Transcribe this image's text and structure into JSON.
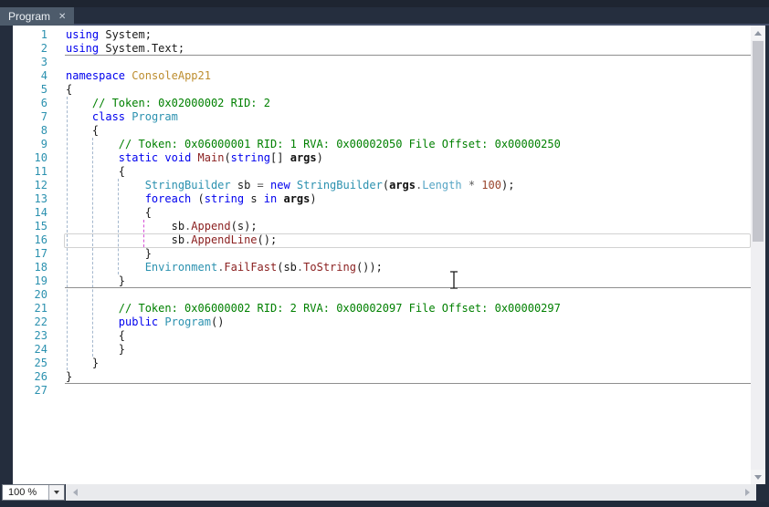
{
  "tab_bar": {
    "tabs": [
      {
        "label": "Program",
        "close_icon": "✕",
        "active": true
      }
    ]
  },
  "zoom_control": {
    "value": "100 %"
  },
  "colors": {
    "chrome_dark": "#242D3D",
    "chrome_top_strip": "#1E2531",
    "tab_active_bg": "#4D5B6B",
    "editor_bg": "#FFFFFF",
    "line_number": "#2B91AF",
    "keyword": "#0000EE",
    "type": "#2B91AF",
    "method": "#8B2121",
    "comment": "#008000",
    "number_literal": "#99442B",
    "namespace_name": "#BD8D2E",
    "property": "#56A5C5",
    "indent_guide": "#A4B7CD",
    "indent_guide_active": "#D651D6",
    "member_separator": "#8F8F8F",
    "current_line_border": "#D2D2D2"
  },
  "editor": {
    "current_line": 16,
    "member_separator_after_lines": [
      2,
      19,
      26
    ],
    "indent_guides": [
      {
        "level": 1,
        "from_line": 6,
        "to_line": 25,
        "active": false
      },
      {
        "level": 2,
        "from_line": 9,
        "to_line": 24,
        "active": false
      },
      {
        "level": 3,
        "from_line": 12,
        "to_line": 18,
        "active": false
      },
      {
        "level": 4,
        "from_line": 15,
        "to_line": 16,
        "active": true
      }
    ],
    "lines": [
      {
        "num": 1,
        "segs": [
          [
            "k",
            "using"
          ],
          [
            "d",
            " System;"
          ]
        ]
      },
      {
        "num": 2,
        "segs": [
          [
            "k",
            "using"
          ],
          [
            "d",
            " System"
          ],
          [
            "o",
            "."
          ],
          [
            "d",
            "Text;"
          ]
        ]
      },
      {
        "num": 3,
        "segs": []
      },
      {
        "num": 4,
        "segs": [
          [
            "k",
            "namespace"
          ],
          [
            "d",
            " "
          ],
          [
            "ns",
            "ConsoleApp21"
          ]
        ]
      },
      {
        "num": 5,
        "segs": [
          [
            "d",
            "{"
          ]
        ]
      },
      {
        "num": 6,
        "segs": [
          [
            "d",
            "    "
          ],
          [
            "c",
            "// Token: 0x02000002 RID: 2"
          ]
        ]
      },
      {
        "num": 7,
        "segs": [
          [
            "d",
            "    "
          ],
          [
            "k",
            "class"
          ],
          [
            "d",
            " "
          ],
          [
            "t",
            "Program"
          ]
        ]
      },
      {
        "num": 8,
        "segs": [
          [
            "d",
            "    {"
          ]
        ]
      },
      {
        "num": 9,
        "segs": [
          [
            "d",
            "        "
          ],
          [
            "c",
            "// Token: 0x06000001 RID: 1 RVA: 0x00002050 File Offset: 0x00000250"
          ]
        ]
      },
      {
        "num": 10,
        "segs": [
          [
            "d",
            "        "
          ],
          [
            "k",
            "static"
          ],
          [
            "d",
            " "
          ],
          [
            "k",
            "void"
          ],
          [
            "d",
            " "
          ],
          [
            "m",
            "Main"
          ],
          [
            "d",
            "("
          ],
          [
            "k",
            "string"
          ],
          [
            "d",
            "[] "
          ],
          [
            "b",
            "args"
          ],
          [
            "d",
            ")"
          ]
        ]
      },
      {
        "num": 11,
        "segs": [
          [
            "d",
            "        {"
          ]
        ]
      },
      {
        "num": 12,
        "segs": [
          [
            "d",
            "            "
          ],
          [
            "t",
            "StringBuilder"
          ],
          [
            "d",
            " sb "
          ],
          [
            "o",
            "="
          ],
          [
            "d",
            " "
          ],
          [
            "k",
            "new"
          ],
          [
            "d",
            " "
          ],
          [
            "t",
            "StringBuilder"
          ],
          [
            "d",
            "("
          ],
          [
            "b",
            "args"
          ],
          [
            "o",
            "."
          ],
          [
            "pr",
            "Length"
          ],
          [
            "d",
            " "
          ],
          [
            "o",
            "*"
          ],
          [
            "d",
            " "
          ],
          [
            "n",
            "100"
          ],
          [
            "d",
            ");"
          ]
        ]
      },
      {
        "num": 13,
        "segs": [
          [
            "d",
            "            "
          ],
          [
            "k",
            "foreach"
          ],
          [
            "d",
            " ("
          ],
          [
            "k",
            "string"
          ],
          [
            "d",
            " s "
          ],
          [
            "k",
            "in"
          ],
          [
            "d",
            " "
          ],
          [
            "b",
            "args"
          ],
          [
            "d",
            ")"
          ]
        ]
      },
      {
        "num": 14,
        "segs": [
          [
            "d",
            "            {"
          ]
        ]
      },
      {
        "num": 15,
        "segs": [
          [
            "d",
            "                sb"
          ],
          [
            "o",
            "."
          ],
          [
            "m",
            "Append"
          ],
          [
            "d",
            "(s);"
          ]
        ]
      },
      {
        "num": 16,
        "segs": [
          [
            "d",
            "                sb"
          ],
          [
            "o",
            "."
          ],
          [
            "m",
            "AppendLine"
          ],
          [
            "d",
            "();"
          ]
        ]
      },
      {
        "num": 17,
        "segs": [
          [
            "d",
            "            }"
          ]
        ]
      },
      {
        "num": 18,
        "segs": [
          [
            "d",
            "            "
          ],
          [
            "t",
            "Environment"
          ],
          [
            "o",
            "."
          ],
          [
            "m",
            "FailFast"
          ],
          [
            "d",
            "(sb"
          ],
          [
            "o",
            "."
          ],
          [
            "m",
            "ToString"
          ],
          [
            "d",
            "());"
          ]
        ]
      },
      {
        "num": 19,
        "segs": [
          [
            "d",
            "        }"
          ]
        ]
      },
      {
        "num": 20,
        "segs": []
      },
      {
        "num": 21,
        "segs": [
          [
            "d",
            "        "
          ],
          [
            "c",
            "// Token: 0x06000002 RID: 2 RVA: 0x00002097 File Offset: 0x00000297"
          ]
        ]
      },
      {
        "num": 22,
        "segs": [
          [
            "d",
            "        "
          ],
          [
            "k",
            "public"
          ],
          [
            "d",
            " "
          ],
          [
            "t",
            "Program"
          ],
          [
            "d",
            "()"
          ]
        ]
      },
      {
        "num": 23,
        "segs": [
          [
            "d",
            "        {"
          ]
        ]
      },
      {
        "num": 24,
        "segs": [
          [
            "d",
            "        }"
          ]
        ]
      },
      {
        "num": 25,
        "segs": [
          [
            "d",
            "    }"
          ]
        ]
      },
      {
        "num": 26,
        "segs": [
          [
            "d",
            "}"
          ]
        ]
      },
      {
        "num": 27,
        "segs": []
      }
    ]
  }
}
